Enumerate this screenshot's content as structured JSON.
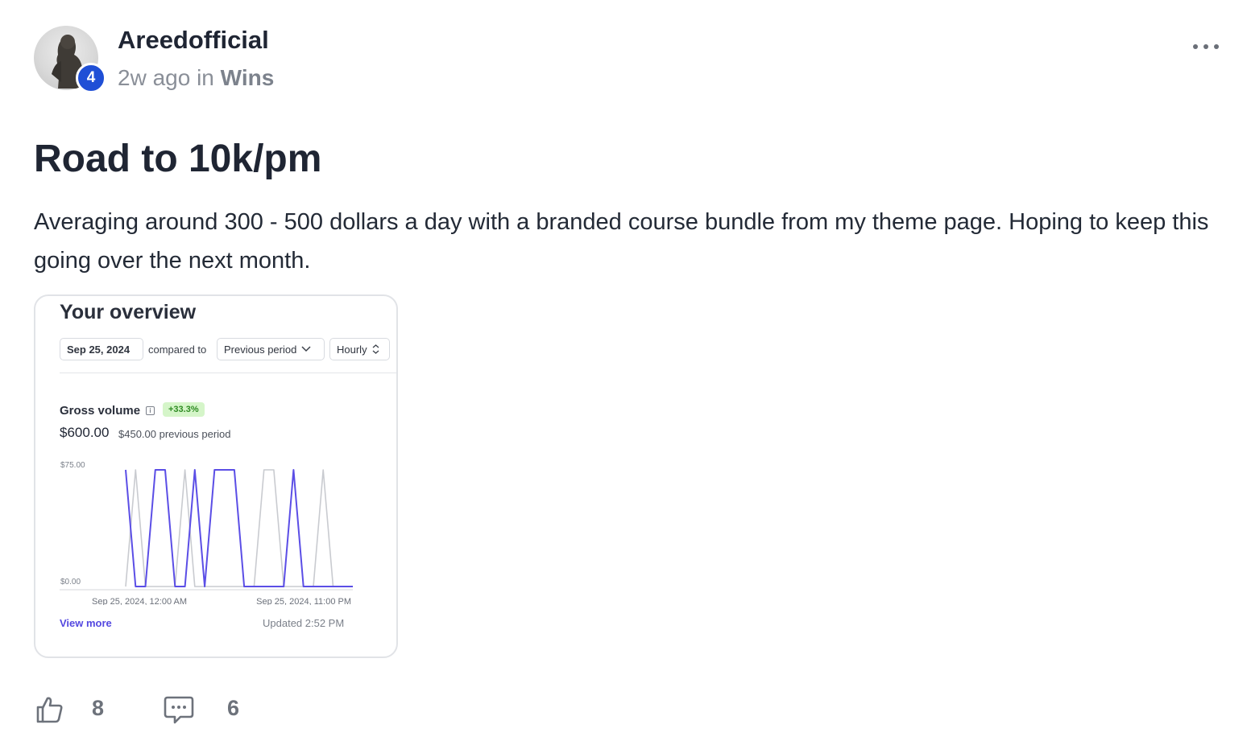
{
  "author": {
    "name": "Areedofficial",
    "level": "4",
    "avatar_icon": "statue-avatar"
  },
  "meta": {
    "time": "2w ago",
    "in_word": "in",
    "category": "Wins"
  },
  "post": {
    "title": "Road to 10k/pm",
    "body": "Averaging around 300 - 500 dollars a day with a branded course bundle from my theme page. Hoping to keep this going over the next month."
  },
  "overview": {
    "title": "Your overview",
    "date": "Sep 25, 2024",
    "compared_to": "compared to",
    "period": "Previous period",
    "granularity": "Hourly",
    "metric_label": "Gross volume",
    "growth": "+33.3%",
    "value": "$600.00",
    "previous": "$450.00 previous period",
    "view_more": "View more",
    "updated": "Updated 2:52 PM"
  },
  "chart_data": {
    "type": "line",
    "title": "Gross volume",
    "x_start_label": "Sep 25, 2024, 12:00 AM",
    "x_end_label": "Sep 25, 2024, 11:00 PM",
    "y_tick_labels": [
      "$75.00",
      "$0.00"
    ],
    "ylim": [
      0,
      75
    ],
    "x": [
      0,
      1,
      2,
      3,
      4,
      5,
      6,
      7,
      8,
      9,
      10,
      11,
      12,
      13,
      14,
      15,
      16,
      17,
      18,
      19,
      20,
      21,
      22,
      23
    ],
    "series": [
      {
        "name": "",
        "color": "#5b4ee6",
        "values": [
          75,
          0,
          0,
          75,
          75,
          0,
          0,
          75,
          0,
          75,
          75,
          75,
          0,
          0,
          0,
          0,
          0,
          75,
          0,
          0,
          0,
          0,
          0,
          0
        ]
      },
      {
        "name": "",
        "color": "#c9cbd0",
        "values": [
          0,
          75,
          0,
          0,
          0,
          0,
          75,
          0,
          0,
          0,
          0,
          0,
          0,
          0,
          75,
          75,
          0,
          0,
          0,
          0,
          75,
          0,
          0,
          0
        ]
      }
    ]
  },
  "reactions": {
    "likes": "8",
    "comments": "6"
  },
  "colors": {
    "badge": "#1f4fd6",
    "accent": "#5448e0",
    "growth_bg": "#d5f5c9"
  }
}
